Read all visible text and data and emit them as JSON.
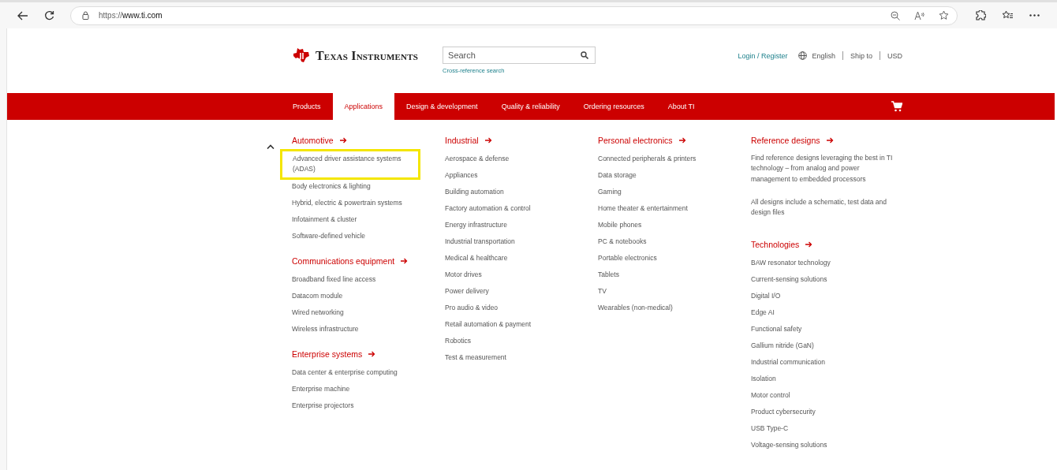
{
  "browser": {
    "url_prefix": "https://",
    "url_host": "www.ti.com"
  },
  "header": {
    "logo": "Texas Instruments",
    "search": {
      "placeholder": "Search"
    },
    "cross_reference": "Cross-reference search",
    "login": "Login / Register",
    "language": "English",
    "ship_to": "Ship to",
    "currency": "USD"
  },
  "nav": {
    "tabs": [
      {
        "label": "Products",
        "selected": false
      },
      {
        "label": "Applications",
        "selected": true
      },
      {
        "label": "Design & development",
        "selected": false
      },
      {
        "label": "Quality & reliability",
        "selected": false
      },
      {
        "label": "Ordering resources",
        "selected": false
      },
      {
        "label": "About TI",
        "selected": false
      }
    ]
  },
  "menu": {
    "expanded": true,
    "columns": [
      {
        "sections": [
          {
            "kind": "links",
            "heading": "Automotive",
            "items": [
              {
                "label": "Advanced driver assistance systems (ADAS)",
                "highlighted": true
              },
              {
                "label": "Body electronics & lighting",
                "highlighted": false
              },
              {
                "label": "Hybrid, electric & powertrain systems",
                "highlighted": false
              },
              {
                "label": "Infotainment & cluster",
                "highlighted": false
              },
              {
                "label": "Software-defined vehicle",
                "highlighted": false
              }
            ]
          },
          {
            "kind": "links",
            "heading": "Communications equipment",
            "items": [
              {
                "label": "Broadband fixed line access",
                "highlighted": false
              },
              {
                "label": "Datacom module",
                "highlighted": false
              },
              {
                "label": "Wired networking",
                "highlighted": false
              },
              {
                "label": "Wireless infrastructure",
                "highlighted": false
              }
            ]
          },
          {
            "kind": "links",
            "heading": "Enterprise systems",
            "items": [
              {
                "label": "Data center & enterprise computing",
                "highlighted": false
              },
              {
                "label": "Enterprise machine",
                "highlighted": false
              },
              {
                "label": "Enterprise projectors",
                "highlighted": false
              }
            ]
          }
        ]
      },
      {
        "sections": [
          {
            "kind": "links",
            "heading": "Industrial",
            "items": [
              {
                "label": "Aerospace & defense",
                "highlighted": false
              },
              {
                "label": "Appliances",
                "highlighted": false
              },
              {
                "label": "Building automation",
                "highlighted": false
              },
              {
                "label": "Factory automation & control",
                "highlighted": false
              },
              {
                "label": "Energy infrastructure",
                "highlighted": false
              },
              {
                "label": "Industrial transportation",
                "highlighted": false
              },
              {
                "label": "Medical & healthcare",
                "highlighted": false
              },
              {
                "label": "Motor drives",
                "highlighted": false
              },
              {
                "label": "Power delivery",
                "highlighted": false
              },
              {
                "label": "Pro audio & video",
                "highlighted": false
              },
              {
                "label": "Retail automation & payment",
                "highlighted": false
              },
              {
                "label": "Robotics",
                "highlighted": false
              },
              {
                "label": "Test & measurement",
                "highlighted": false
              }
            ]
          }
        ]
      },
      {
        "sections": [
          {
            "kind": "links",
            "heading": "Personal electronics",
            "items": [
              {
                "label": "Connected peripherals & printers",
                "highlighted": false
              },
              {
                "label": "Data storage",
                "highlighted": false
              },
              {
                "label": "Gaming",
                "highlighted": false
              },
              {
                "label": "Home theater & entertainment",
                "highlighted": false
              },
              {
                "label": "Mobile phones",
                "highlighted": false
              },
              {
                "label": "PC & notebooks",
                "highlighted": false
              },
              {
                "label": "Portable electronics",
                "highlighted": false
              },
              {
                "label": "Tablets",
                "highlighted": false
              },
              {
                "label": "TV",
                "highlighted": false
              },
              {
                "label": "Wearables (non-medical)",
                "highlighted": false
              }
            ]
          }
        ]
      },
      {
        "sections": [
          {
            "kind": "text",
            "heading": "Reference designs",
            "paragraphs": [
              "Find reference designs leveraging the best in TI technology – from analog and power management to embedded processors",
              "All designs include a schematic, test data and design files"
            ]
          },
          {
            "kind": "links",
            "heading": "Technologies",
            "items": [
              {
                "label": "BAW resonator technology",
                "highlighted": false
              },
              {
                "label": "Current-sensing solutions",
                "highlighted": false
              },
              {
                "label": "Digital I/O",
                "highlighted": false
              },
              {
                "label": "Edge AI",
                "highlighted": false
              },
              {
                "label": "Functional safety",
                "highlighted": false
              },
              {
                "label": "Gallium nitride (GaN)",
                "highlighted": false
              },
              {
                "label": "Industrial communication",
                "highlighted": false
              },
              {
                "label": "Isolation",
                "highlighted": false
              },
              {
                "label": "Motor control",
                "highlighted": false
              },
              {
                "label": "Product cybersecurity",
                "highlighted": false
              },
              {
                "label": "USB Type-C",
                "highlighted": false
              },
              {
                "label": "Voltage-sensing solutions",
                "highlighted": false
              }
            ]
          }
        ]
      }
    ]
  }
}
